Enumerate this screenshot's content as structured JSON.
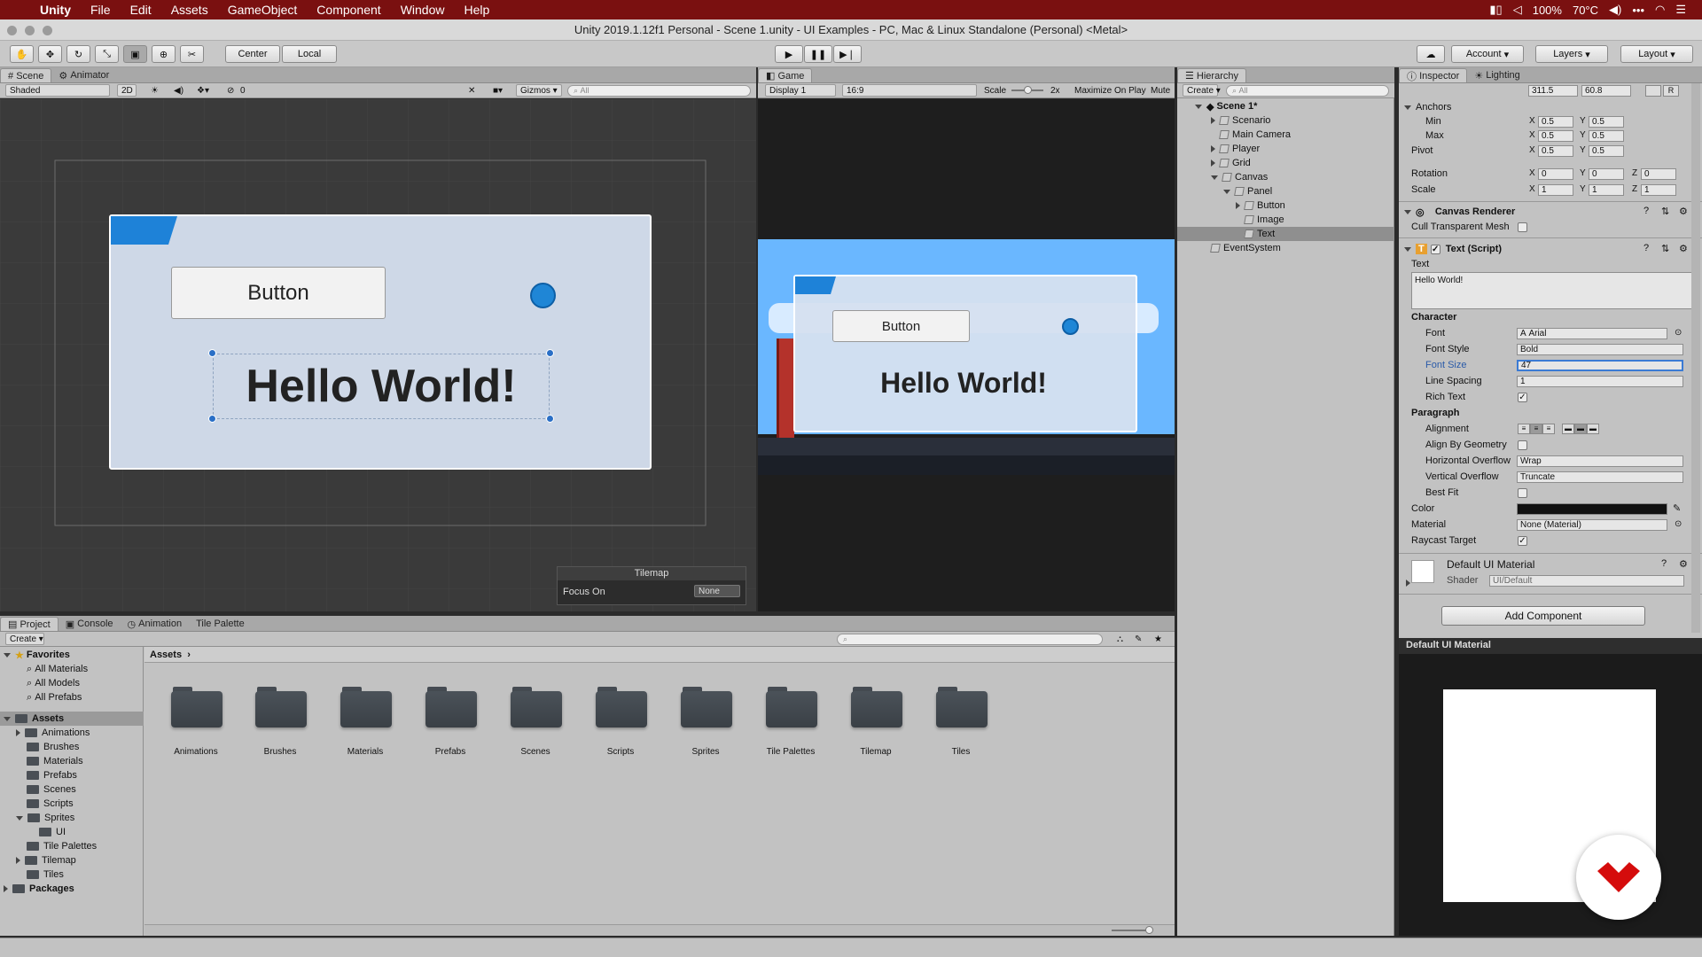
{
  "menubar": {
    "app": "Unity",
    "items": [
      "File",
      "Edit",
      "Assets",
      "GameObject",
      "Component",
      "Window",
      "Help"
    ],
    "battery": "100%",
    "temp": "70°C"
  },
  "window_title": "Unity 2019.1.12f1 Personal - Scene 1.unity - UI Examples - PC, Mac & Linux Standalone (Personal) <Metal>",
  "toolbar": {
    "pivot_label": "Center",
    "space_label": "Local",
    "account_label": "Account",
    "layers_label": "Layers",
    "layout_label": "Layout"
  },
  "scene": {
    "tabs": [
      "Scene",
      "Animator"
    ],
    "shading": "Shaded",
    "mode_2d": "2D",
    "gizmos": "Gizmos",
    "search_placeholder": "All",
    "hidden_count": "0",
    "button_label": "Button",
    "text": "Hello World!",
    "tilemap_label": "Tilemap",
    "focus_on_label": "Focus On",
    "focus_on_value": "None"
  },
  "game": {
    "tab": "Game",
    "display": "Display 1",
    "aspect": "16:9",
    "scale_label": "Scale",
    "scale_value": "2x",
    "maximize": "Maximize On Play",
    "mute": "Mute",
    "button_label": "Button",
    "text": "Hello World!"
  },
  "hierarchy": {
    "tab": "Hierarchy",
    "create": "Create",
    "search_placeholder": "All",
    "scene_name": "Scene 1*",
    "items": [
      "Scenario",
      "Main Camera",
      "Player",
      "Grid",
      "Canvas",
      "Panel",
      "Button",
      "Image",
      "Text",
      "EventSystem"
    ]
  },
  "inspector": {
    "tabs": [
      "Inspector",
      "Lighting"
    ],
    "width_value": "311.5",
    "height_value": "60.8",
    "anchors_label": "Anchors",
    "min_label": "Min",
    "max_label": "Max",
    "pivot_label": "Pivot",
    "rotation_label": "Rotation",
    "scale_label": "Scale",
    "anchor_min": [
      "0.5",
      "0.5"
    ],
    "anchor_max": [
      "0.5",
      "0.5"
    ],
    "pivot": [
      "0.5",
      "0.5"
    ],
    "rotation": [
      "0",
      "0",
      "0"
    ],
    "scale": [
      "1",
      "1",
      "1"
    ],
    "canvas_renderer": "Canvas Renderer",
    "cull_transparent": "Cull Transparent Mesh",
    "text_script": "Text (Script)",
    "text_label": "Text",
    "text_value": "Hello World!",
    "character_label": "Character",
    "font_label": "Font",
    "font_value": "Arial",
    "font_style_label": "Font Style",
    "font_style_value": "Bold",
    "font_size_label": "Font Size",
    "font_size_value": "47",
    "line_spacing_label": "Line Spacing",
    "line_spacing_value": "1",
    "rich_text_label": "Rich Text",
    "paragraph_label": "Paragraph",
    "alignment_label": "Alignment",
    "align_geometry_label": "Align By Geometry",
    "h_overflow_label": "Horizontal Overflow",
    "h_overflow_value": "Wrap",
    "v_overflow_label": "Vertical Overflow",
    "v_overflow_value": "Truncate",
    "best_fit_label": "Best Fit",
    "color_label": "Color",
    "material_label": "Material",
    "material_value": "None (Material)",
    "raycast_label": "Raycast Target",
    "default_material": "Default UI Material",
    "shader_label": "Shader",
    "shader_value": "UI/Default",
    "add_component": "Add Component",
    "preview_title": "Default UI Material",
    "checkmark": "✓"
  },
  "project": {
    "tabs": [
      "Project",
      "Console",
      "Animation",
      "Tile Palette"
    ],
    "create": "Create",
    "favorites_label": "Favorites",
    "favorites": [
      "All Materials",
      "All Models",
      "All Prefabs"
    ],
    "assets_label": "Assets",
    "asset_tree": [
      "Animations",
      "Brushes",
      "Materials",
      "Prefabs",
      "Scenes",
      "Scripts",
      "Sprites",
      "UI",
      "Tile Palettes",
      "Tilemap",
      "Tiles"
    ],
    "packages_label": "Packages",
    "breadcrumb": "Assets",
    "folders": [
      "Animations",
      "Brushes",
      "Materials",
      "Prefabs",
      "Scenes",
      "Scripts",
      "Sprites",
      "Tile Palettes",
      "Tilemap",
      "Tiles"
    ]
  },
  "colors": {
    "menubar": "#7a1010",
    "accent_blue": "#1f86d6",
    "text_color_swatch": "#111111"
  }
}
